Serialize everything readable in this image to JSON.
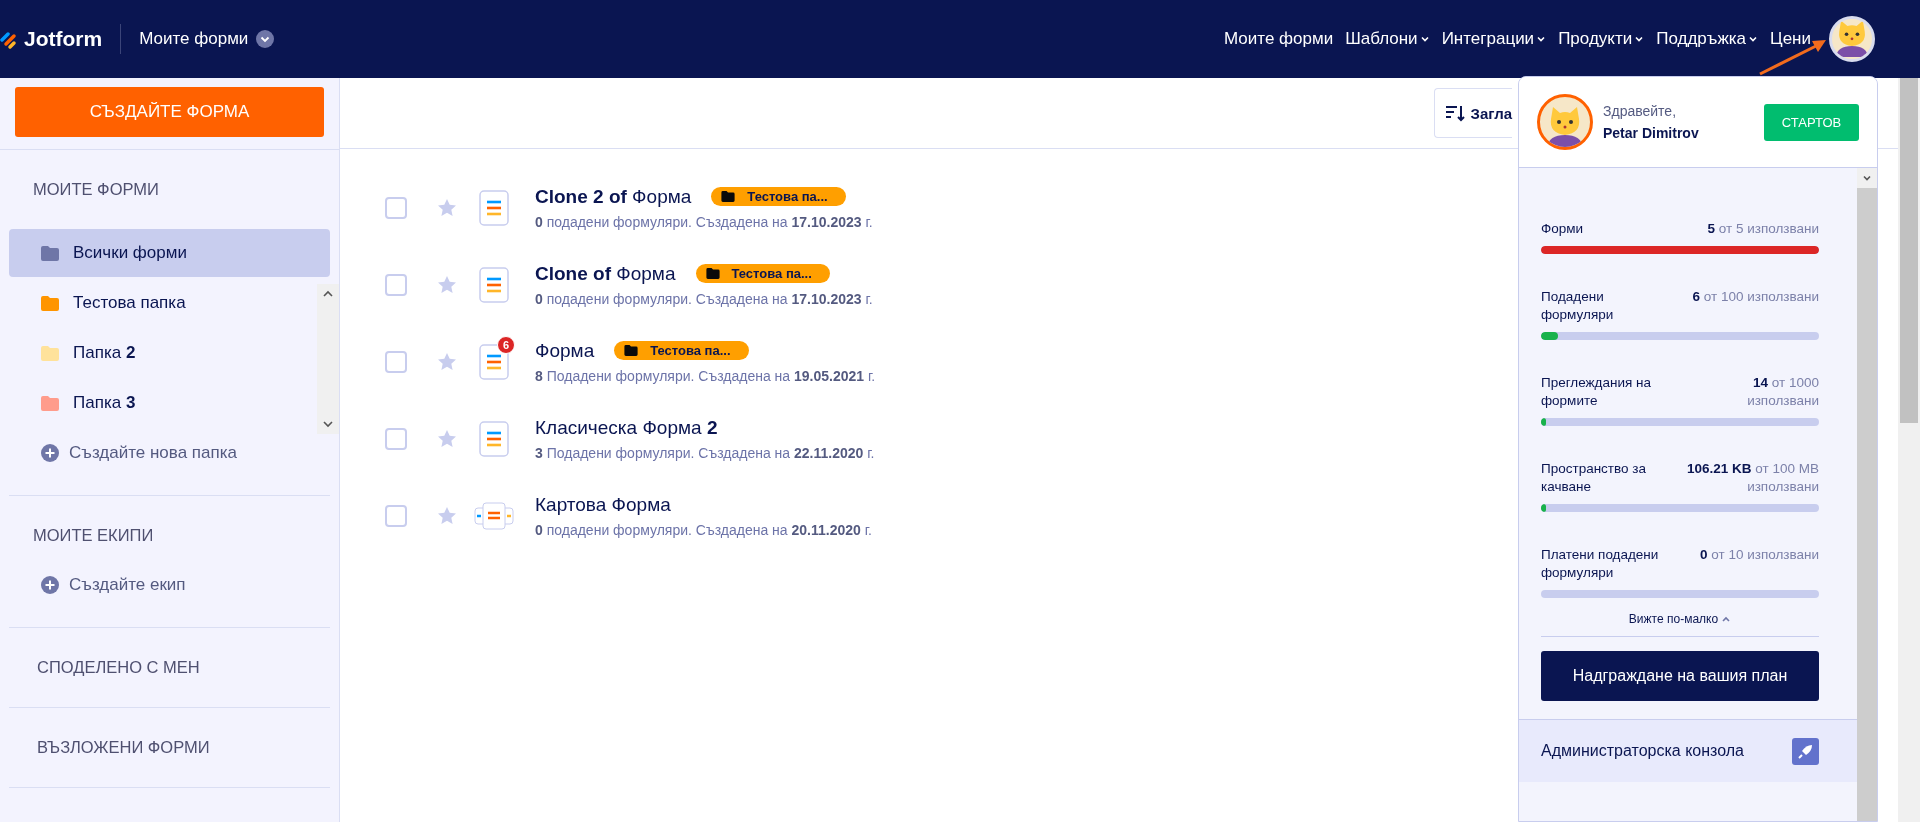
{
  "header": {
    "logo": "Jotform",
    "workspace": "Моите форми",
    "nav": [
      {
        "label": "Моите форми",
        "dropdown": false
      },
      {
        "label": "Шаблони",
        "dropdown": true
      },
      {
        "label": "Интеграции",
        "dropdown": true
      },
      {
        "label": "Продукти",
        "dropdown": true
      },
      {
        "label": "Поддръжка",
        "dropdown": true
      },
      {
        "label": "Цени",
        "dropdown": false
      }
    ]
  },
  "sidebar": {
    "create_button": "СЪЗДАЙТЕ ФОРМА",
    "my_forms_title": "МОИТЕ ФОРМИ",
    "folders": [
      {
        "label": "Всички форми",
        "color": "#6f76a7",
        "selected": true
      },
      {
        "label": "Тестова папка",
        "color": "#ff9500",
        "selected": false
      },
      {
        "label": "Папка **2**",
        "color": "#ffe29b",
        "selected": false
      },
      {
        "label": "Папка **3**",
        "color": "#ff9c8c",
        "selected": false
      }
    ],
    "new_folder": "Създайте нова папка",
    "teams_title": "МОИТЕ ЕКИПИ",
    "new_team": "Създайте екип",
    "shared_title": "СПОДЕЛЕНО С МЕН",
    "assigned_title": "ВЪЗЛОЖЕНИ ФОРМИ"
  },
  "toolbar": {
    "sort_button": "Загла"
  },
  "forms": [
    {
      "title": "**Clone 2 of** Форма",
      "meta": "**0** подадени формуляри. Създадена на **17.10.2023** г.",
      "folder_tag": "Тестова па...",
      "kind": "form",
      "checked": false
    },
    {
      "title": "**Clone of** Форма",
      "meta": "**0** подадени формуляри. Създадена на **17.10.2023** г.",
      "folder_tag": "Тестова па...",
      "kind": "form",
      "checked": false
    },
    {
      "title": "Форма",
      "meta": "**8** Подадени формуляри. Създадена на **19.05.2021** г.",
      "folder_tag": "Тестова па...",
      "badge": "6",
      "kind": "form",
      "checked": false
    },
    {
      "title": "Класическа Форма **2**",
      "meta": "**3** Подадени формуляри. Създадена на **22.11.2020** г.",
      "kind": "form",
      "checked": false
    },
    {
      "title": "Картова Форма",
      "meta": "**0** подадени формуляри. Създадена на **20.11.2020** г.",
      "kind": "card",
      "checked": false
    }
  ],
  "account_menu": {
    "greeting": "Здравейте,",
    "name": "Petar Dimitrov",
    "plan_button": "СТАРТОВ",
    "usage": [
      {
        "label": "Форми",
        "reading": "**5** от 5 използвани",
        "level": 1,
        "color": "#dc2626"
      },
      {
        "label": "Подадени формуляри",
        "reading": "**6** от 100 използвани",
        "level": 0.06,
        "color": "#18b24b"
      },
      {
        "label": "Преглеждания на формите",
        "reading": "**14** от 1000 използвани",
        "level": 0.014,
        "color": "#18b24b"
      },
      {
        "label": "Пространство за качване",
        "reading": "**106.21 KB** от 100 MB използвани",
        "level": 0.01,
        "color": "#18b24b"
      },
      {
        "label": "Платени подадени формуляри",
        "reading": "**0** от 10 използвани",
        "level": 0
      }
    ],
    "see_less": "Вижте по-малко",
    "upgrade_button": "Надграждане на вашия план",
    "admin_console": "Администраторска конзола"
  }
}
